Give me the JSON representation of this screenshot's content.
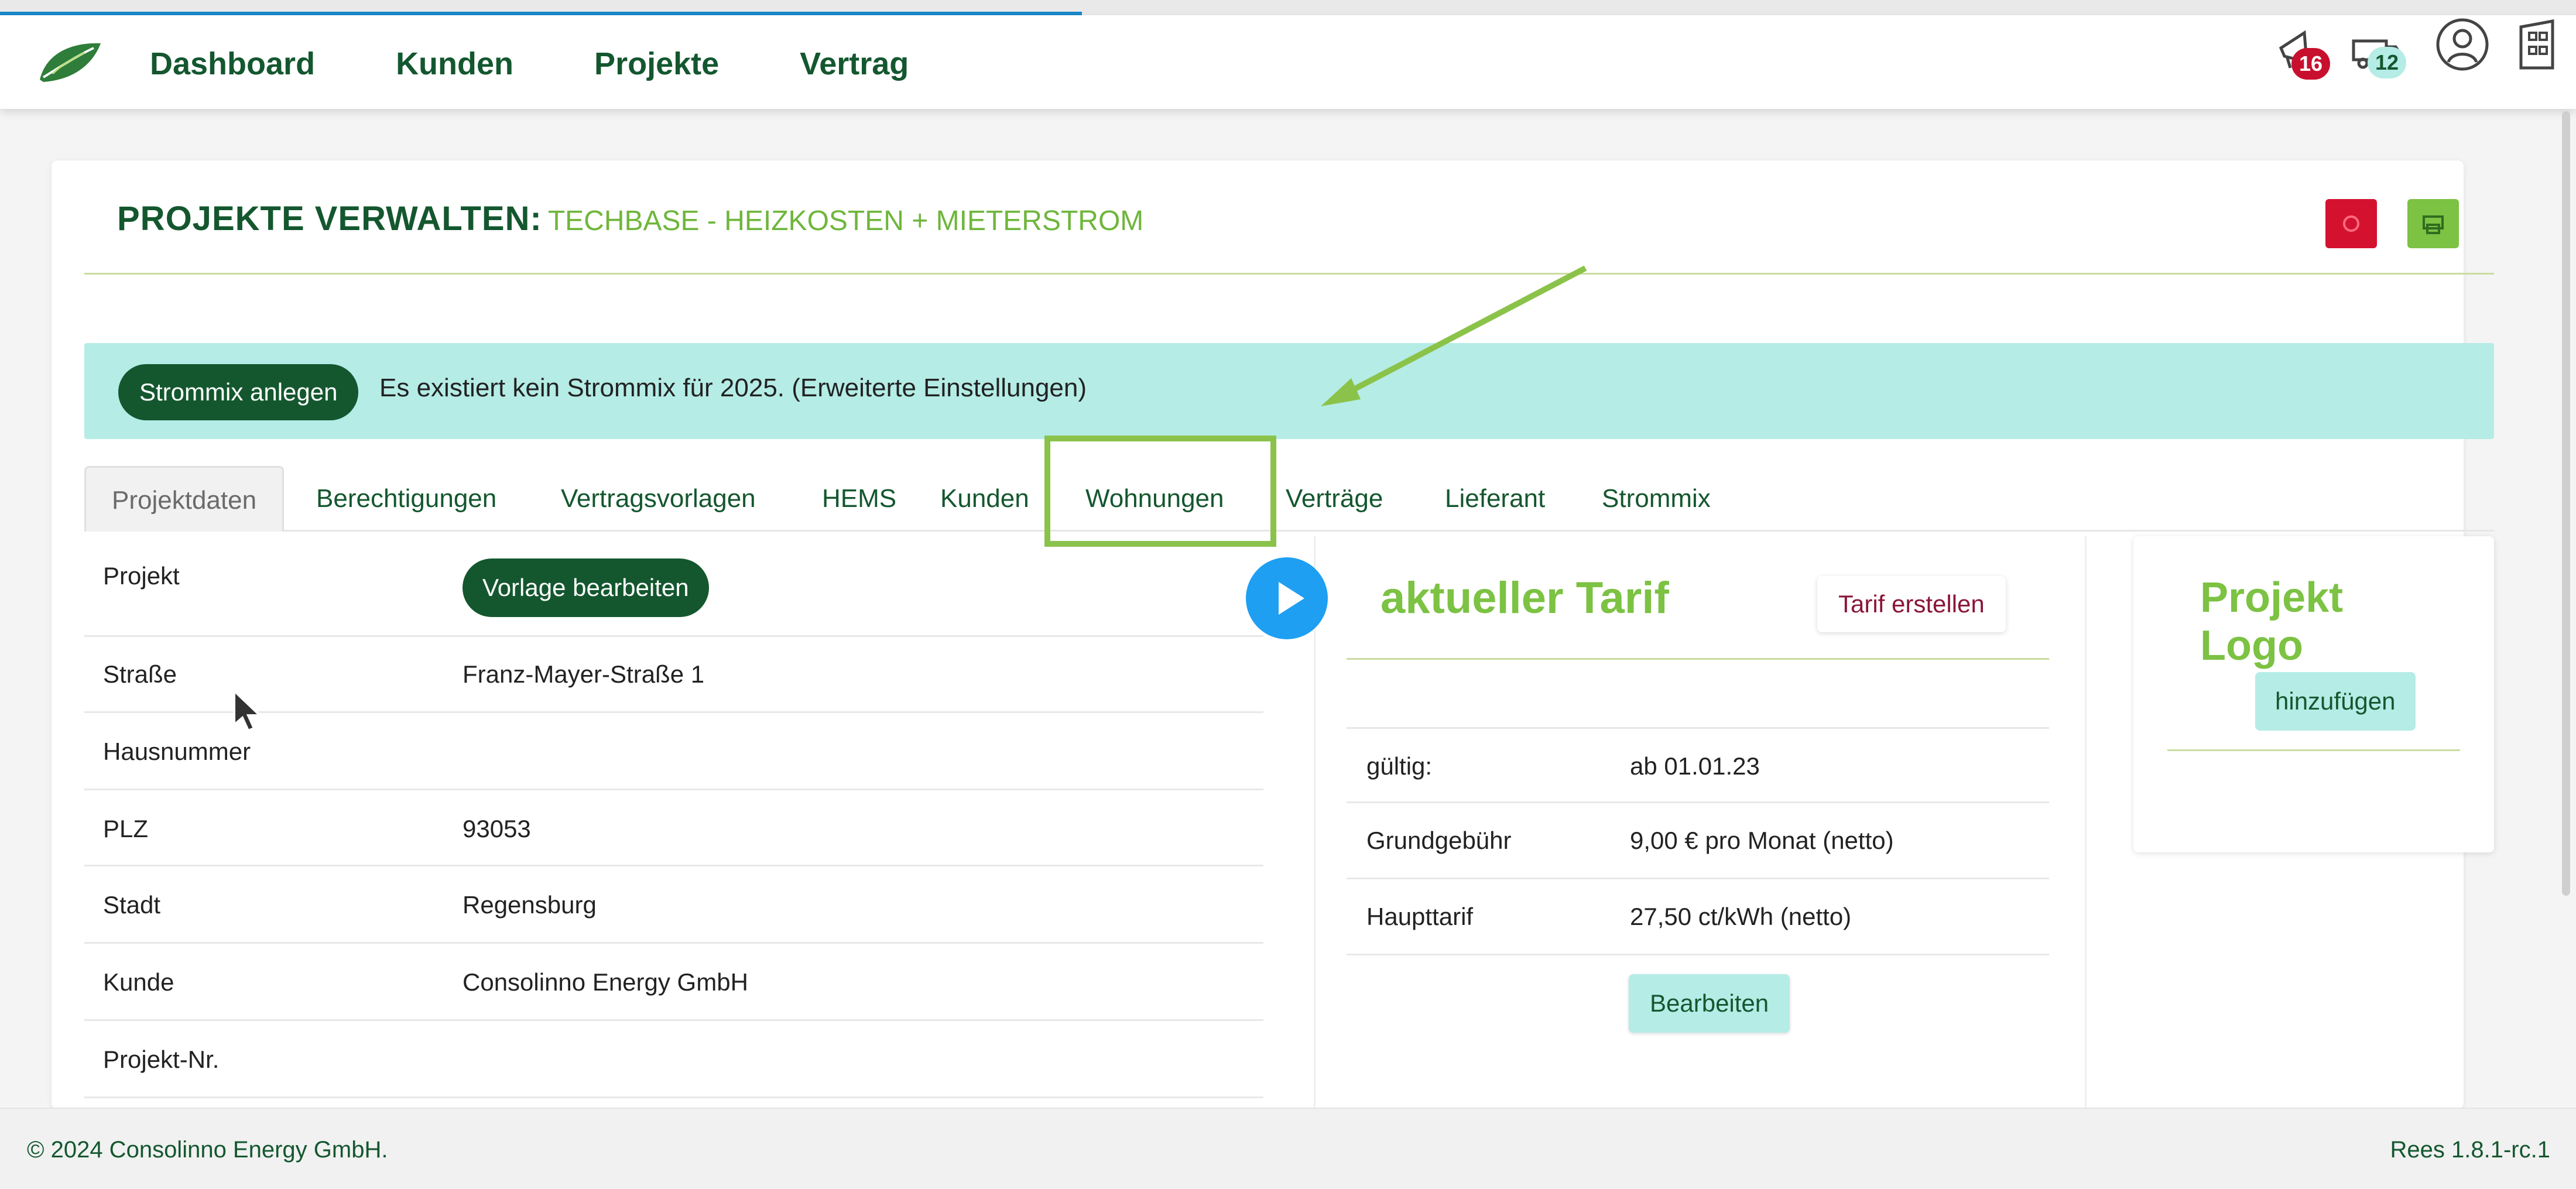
{
  "header": {
    "nav": [
      "Dashboard",
      "Kunden",
      "Projekte",
      "Vertrag"
    ],
    "notifications_badge": "16",
    "delivery_badge": "12",
    "icons": [
      "leaf-logo-icon",
      "notification-megaphone-icon",
      "truck-icon",
      "user-avatar-icon",
      "building-icon"
    ]
  },
  "page": {
    "title_strong": "PROJEKTE VERWALTEN:",
    "title_sub": "TECHBASE - HEIZKOSTEN + MIETERSTROM"
  },
  "banner": {
    "button_label": "Strommix anlegen",
    "text": "Es existiert kein Strommix für 2025. (Erweiterte Einstellungen)"
  },
  "tabs": [
    "Projektdaten",
    "Berechtigungen",
    "Vertragsvorlagen",
    "HEMS",
    "Kunden",
    "Wohnungen",
    "Verträge",
    "Lieferant",
    "Strommix"
  ],
  "project": {
    "rows": [
      {
        "label": "Projekt",
        "value": ""
      },
      {
        "label": "Straße",
        "value": "Franz-Mayer-Straße 1"
      },
      {
        "label": "Hausnummer",
        "value": ""
      },
      {
        "label": "PLZ",
        "value": "93053"
      },
      {
        "label": "Stadt",
        "value": "Regensburg"
      },
      {
        "label": "Kunde",
        "value": "Consolinno Energy GmbH"
      },
      {
        "label": "Projekt-Nr.",
        "value": ""
      }
    ],
    "vorlage_button": "Vorlage bearbeiten"
  },
  "tarif": {
    "title": "aktueller Tarif",
    "create_button": "Tarif erstellen",
    "rows": [
      {
        "label": "gültig:",
        "value": "ab 01.01.23"
      },
      {
        "label": "Grundgebühr",
        "value": "9,00 € pro Monat (netto)"
      },
      {
        "label": "Haupttarif",
        "value": "27,50 ct/kWh (netto)"
      }
    ],
    "edit_button": "Bearbeiten"
  },
  "logo_card": {
    "title": "Projekt Logo",
    "add_button": "hinzufügen"
  },
  "footer": {
    "copyright": "© 2024 Consolinno Energy GmbH.",
    "version": "Rees 1.8.1-rc.1"
  },
  "colors": {
    "brand_dark_green": "#14572f",
    "brand_light_green": "#7cc243",
    "banner_teal": "#b5ece6",
    "alert_red": "#d4122f",
    "play_blue": "#1e9ff2"
  },
  "video_progress_percent": 42
}
